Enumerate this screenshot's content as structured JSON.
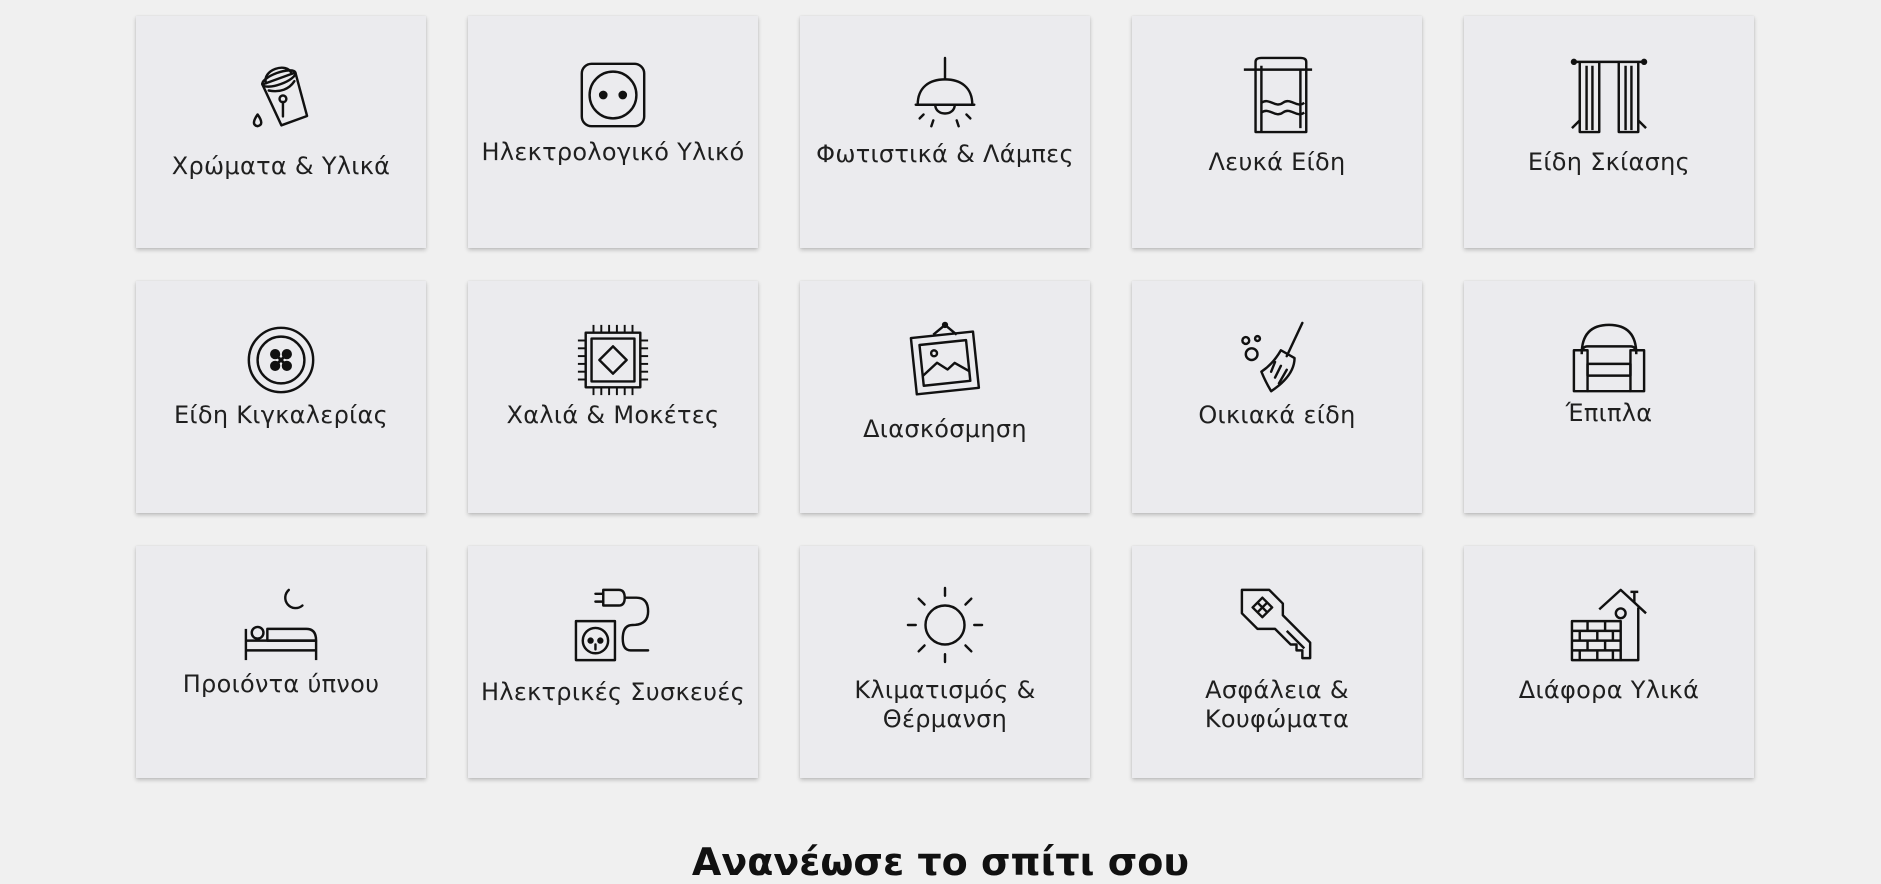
{
  "categories": [
    {
      "label": "Χρώματα & Υλικά",
      "icon": "paint-bucket-icon"
    },
    {
      "label": "Ηλεκτρολογικό Υλικό",
      "icon": "power-socket-icon"
    },
    {
      "label": "Φωτιστικά & Λάμπες",
      "icon": "pendant-lamp-icon"
    },
    {
      "label": "Λευκά Είδη",
      "icon": "towel-icon"
    },
    {
      "label": "Είδη Σκίασης",
      "icon": "curtains-icon"
    },
    {
      "label": "Είδη Κιγκαλερίας",
      "icon": "button-knob-icon"
    },
    {
      "label": "Χαλιά & Μοκέτες",
      "icon": "rug-icon"
    },
    {
      "label": "Διασκόσμηση",
      "icon": "picture-frame-icon"
    },
    {
      "label": "Οικιακά είδη",
      "icon": "broom-icon"
    },
    {
      "label": "Έπιπλα",
      "icon": "armchair-icon"
    },
    {
      "label": "Προιόντα ύπνου",
      "icon": "bed-moon-icon"
    },
    {
      "label": "Ηλεκτρικές Συσκευές",
      "icon": "plug-socket-icon"
    },
    {
      "label": "Κλιματισμός & Θέρμανση",
      "icon": "sun-icon"
    },
    {
      "label": "Ασφάλεια & Κουφώματα",
      "icon": "house-key-icon"
    },
    {
      "label": "Διάφορα Υλικά",
      "icon": "brick-house-icon"
    }
  ],
  "section": {
    "heading": "Ανανέωσε το σπίτι σου"
  }
}
